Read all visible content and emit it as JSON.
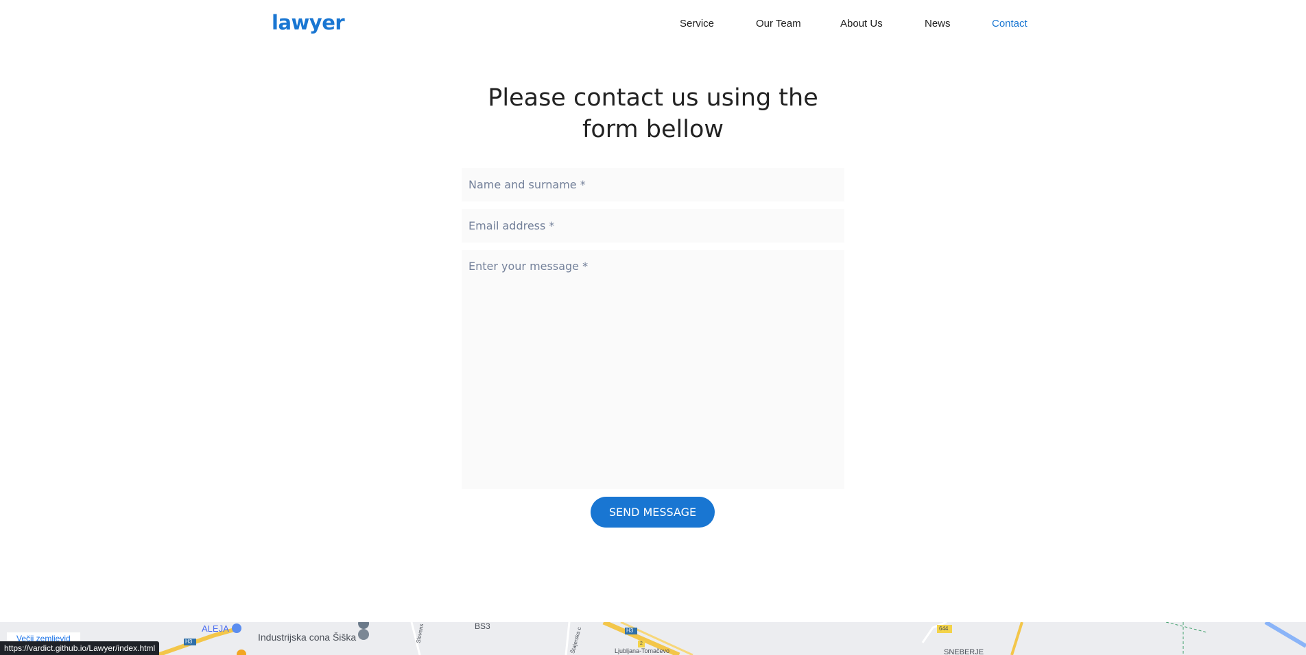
{
  "header": {
    "logo": "lawyer",
    "nav": [
      {
        "label": "Service"
      },
      {
        "label": "Our Team"
      },
      {
        "label": "About Us"
      },
      {
        "label": "News"
      },
      {
        "label": "Contact",
        "active": true
      }
    ]
  },
  "main": {
    "title_line1": "Please contact us using the",
    "title_line2": "form bellow",
    "form": {
      "name_placeholder": "Name and surname *",
      "email_placeholder": "Email address *",
      "message_placeholder": "Enter your message *",
      "send_label": "SEND MESSAGE"
    }
  },
  "map": {
    "larger_map_link": "Večji zemljevid",
    "labels": [
      "ALEJA",
      "Industrijska cona Šiška",
      "BS3",
      "Ljubljana-Tomačevo",
      "SNEBERJE",
      "H3",
      "H3",
      "644",
      "2",
      "Slovens",
      "Štajerska c"
    ]
  },
  "status_bar": {
    "url": "https://vardict.github.io/Lawyer/index.html"
  },
  "colors": {
    "accent": "#1976d2",
    "input_bg": "#fafafa",
    "placeholder": "#74819a"
  }
}
